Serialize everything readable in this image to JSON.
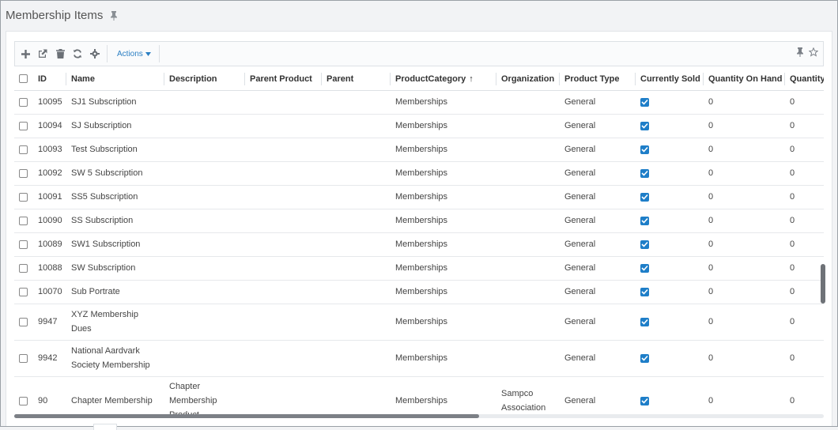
{
  "page": {
    "title": "Membership Items"
  },
  "toolbar": {
    "icons": [
      "add-icon",
      "open-external-icon",
      "trash-icon",
      "refresh-icon",
      "gear-icon"
    ],
    "actions_label": "Actions",
    "right_icons": [
      "pin-icon",
      "star-icon"
    ]
  },
  "columns": [
    "ID",
    "Name",
    "Description",
    "Parent Product",
    "Parent",
    "ProductCategory",
    "Organization",
    "Product Type",
    "Currently Sold",
    "Quantity On Hand",
    "Quantity"
  ],
  "sorted_column": "ProductCategory",
  "sort_direction": "ascending",
  "rows": [
    {
      "id": "10095",
      "name": "SJ1 Subscription",
      "description": "",
      "parent_product": "",
      "parent": "",
      "category": "Memberships",
      "organization": "",
      "product_type": "General",
      "currently_sold": true,
      "qty_on_hand": "0",
      "quantity": "0"
    },
    {
      "id": "10094",
      "name": "SJ Subscription",
      "description": "",
      "parent_product": "",
      "parent": "",
      "category": "Memberships",
      "organization": "",
      "product_type": "General",
      "currently_sold": true,
      "qty_on_hand": "0",
      "quantity": "0"
    },
    {
      "id": "10093",
      "name": "Test Subscription",
      "description": "",
      "parent_product": "",
      "parent": "",
      "category": "Memberships",
      "organization": "",
      "product_type": "General",
      "currently_sold": true,
      "qty_on_hand": "0",
      "quantity": "0"
    },
    {
      "id": "10092",
      "name": "SW 5 Subscription",
      "description": "",
      "parent_product": "",
      "parent": "",
      "category": "Memberships",
      "organization": "",
      "product_type": "General",
      "currently_sold": true,
      "qty_on_hand": "0",
      "quantity": "0"
    },
    {
      "id": "10091",
      "name": "SS5 Subscription",
      "description": "",
      "parent_product": "",
      "parent": "",
      "category": "Memberships",
      "organization": "",
      "product_type": "General",
      "currently_sold": true,
      "qty_on_hand": "0",
      "quantity": "0"
    },
    {
      "id": "10090",
      "name": "SS Subscription",
      "description": "",
      "parent_product": "",
      "parent": "",
      "category": "Memberships",
      "organization": "",
      "product_type": "General",
      "currently_sold": true,
      "qty_on_hand": "0",
      "quantity": "0"
    },
    {
      "id": "10089",
      "name": "SW1 Subscription",
      "description": "",
      "parent_product": "",
      "parent": "",
      "category": "Memberships",
      "organization": "",
      "product_type": "General",
      "currently_sold": true,
      "qty_on_hand": "0",
      "quantity": "0"
    },
    {
      "id": "10088",
      "name": "SW Subscription",
      "description": "",
      "parent_product": "",
      "parent": "",
      "category": "Memberships",
      "organization": "",
      "product_type": "General",
      "currently_sold": true,
      "qty_on_hand": "0",
      "quantity": "0"
    },
    {
      "id": "10070",
      "name": "Sub Portrate",
      "description": "",
      "parent_product": "",
      "parent": "",
      "category": "Memberships",
      "organization": "",
      "product_type": "General",
      "currently_sold": true,
      "qty_on_hand": "0",
      "quantity": "0"
    },
    {
      "id": "9947",
      "name": "XYZ Membership Dues",
      "description": "",
      "parent_product": "",
      "parent": "",
      "category": "Memberships",
      "organization": "",
      "product_type": "General",
      "currently_sold": true,
      "qty_on_hand": "0",
      "quantity": "0"
    },
    {
      "id": "9942",
      "name": "National Aardvark Society Membership",
      "description": "",
      "parent_product": "",
      "parent": "",
      "category": "Memberships",
      "organization": "",
      "product_type": "General",
      "currently_sold": true,
      "qty_on_hand": "0",
      "quantity": "0"
    },
    {
      "id": "90",
      "name": "Chapter Membership",
      "description": "Chapter Membership Product",
      "parent_product": "",
      "parent": "",
      "category": "Memberships",
      "organization": "Sampco Association",
      "product_type": "General",
      "currently_sold": true,
      "qty_on_hand": "0",
      "quantity": "0"
    }
  ]
}
